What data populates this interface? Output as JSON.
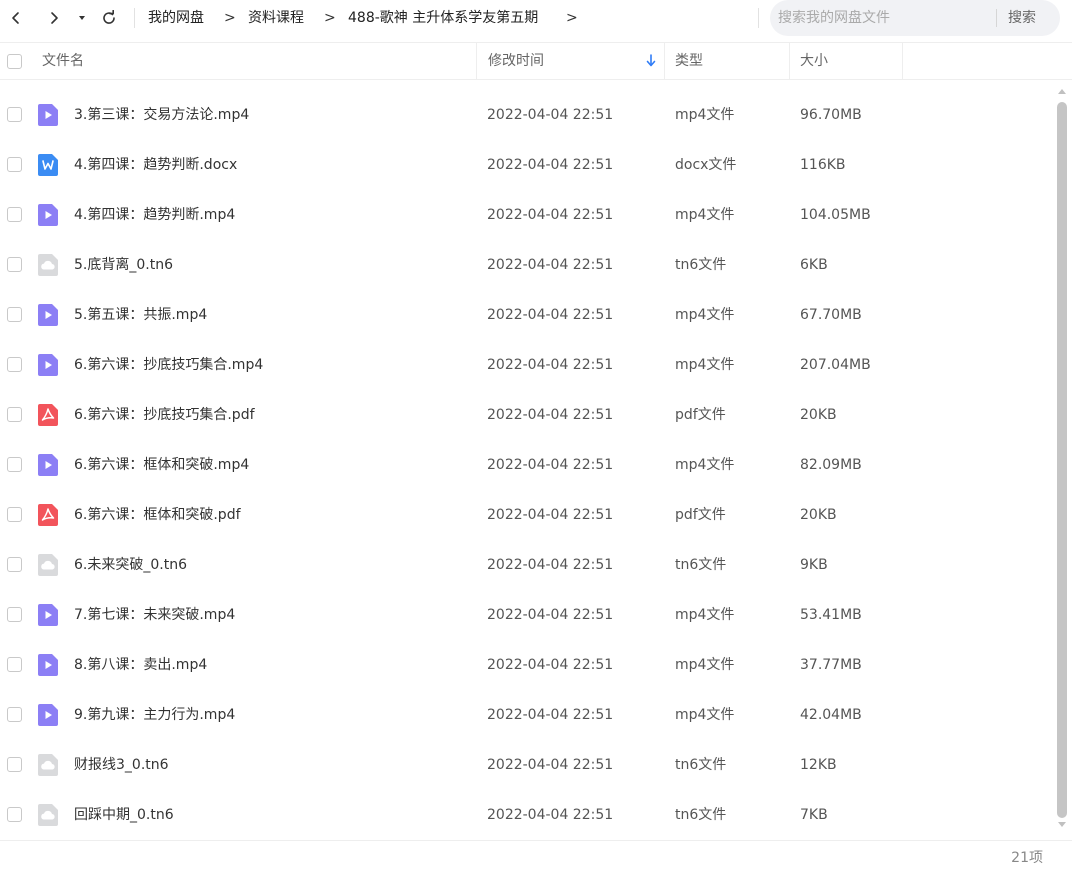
{
  "toolbar": {
    "breadcrumb": [
      "我的网盘",
      "资料课程",
      "488-歌神 主升体系学友第五期"
    ],
    "separator": ">",
    "search_placeholder": "搜索我的网盘文件",
    "search_button": "搜索"
  },
  "header": {
    "name": "文件名",
    "modified": "修改时间",
    "type": "类型",
    "size": "大小",
    "sort_color": "#2f7cf6"
  },
  "files": [
    {
      "icon": "mp4",
      "name": "3.第三课：交易方法论.mp4",
      "date": "2022-04-04 22:51",
      "type": "mp4文件",
      "size": "96.70MB"
    },
    {
      "icon": "docx",
      "name": "4.第四课：趋势判断.docx",
      "date": "2022-04-04 22:51",
      "type": "docx文件",
      "size": "116KB"
    },
    {
      "icon": "mp4",
      "name": "4.第四课：趋势判断.mp4",
      "date": "2022-04-04 22:51",
      "type": "mp4文件",
      "size": "104.05MB"
    },
    {
      "icon": "tn6",
      "name": "5.底背离_0.tn6",
      "date": "2022-04-04 22:51",
      "type": "tn6文件",
      "size": "6KB"
    },
    {
      "icon": "mp4",
      "name": "5.第五课：共振.mp4",
      "date": "2022-04-04 22:51",
      "type": "mp4文件",
      "size": "67.70MB"
    },
    {
      "icon": "mp4",
      "name": "6.第六课：抄底技巧集合.mp4",
      "date": "2022-04-04 22:51",
      "type": "mp4文件",
      "size": "207.04MB"
    },
    {
      "icon": "pdf",
      "name": "6.第六课：抄底技巧集合.pdf",
      "date": "2022-04-04 22:51",
      "type": "pdf文件",
      "size": "20KB"
    },
    {
      "icon": "mp4",
      "name": "6.第六课：框体和突破.mp4",
      "date": "2022-04-04 22:51",
      "type": "mp4文件",
      "size": "82.09MB"
    },
    {
      "icon": "pdf",
      "name": "6.第六课：框体和突破.pdf",
      "date": "2022-04-04 22:51",
      "type": "pdf文件",
      "size": "20KB"
    },
    {
      "icon": "tn6",
      "name": "6.未来突破_0.tn6",
      "date": "2022-04-04 22:51",
      "type": "tn6文件",
      "size": "9KB"
    },
    {
      "icon": "mp4",
      "name": "7.第七课：未来突破.mp4",
      "date": "2022-04-04 22:51",
      "type": "mp4文件",
      "size": "53.41MB"
    },
    {
      "icon": "mp4",
      "name": "8.第八课：卖出.mp4",
      "date": "2022-04-04 22:51",
      "type": "mp4文件",
      "size": "37.77MB"
    },
    {
      "icon": "mp4",
      "name": "9.第九课：主力行为.mp4",
      "date": "2022-04-04 22:51",
      "type": "mp4文件",
      "size": "42.04MB"
    },
    {
      "icon": "tn6",
      "name": "财报线3_0.tn6",
      "date": "2022-04-04 22:51",
      "type": "tn6文件",
      "size": "12KB"
    },
    {
      "icon": "tn6",
      "name": "回踩中期_0.tn6",
      "date": "2022-04-04 22:51",
      "type": "tn6文件",
      "size": "7KB"
    }
  ],
  "icon_colors": {
    "mp4": "#8c7ff5",
    "docx": "#3b8cf3",
    "pdf": "#f2545b",
    "tn6": "#d9dadc"
  },
  "footer": {
    "count": "21项"
  }
}
